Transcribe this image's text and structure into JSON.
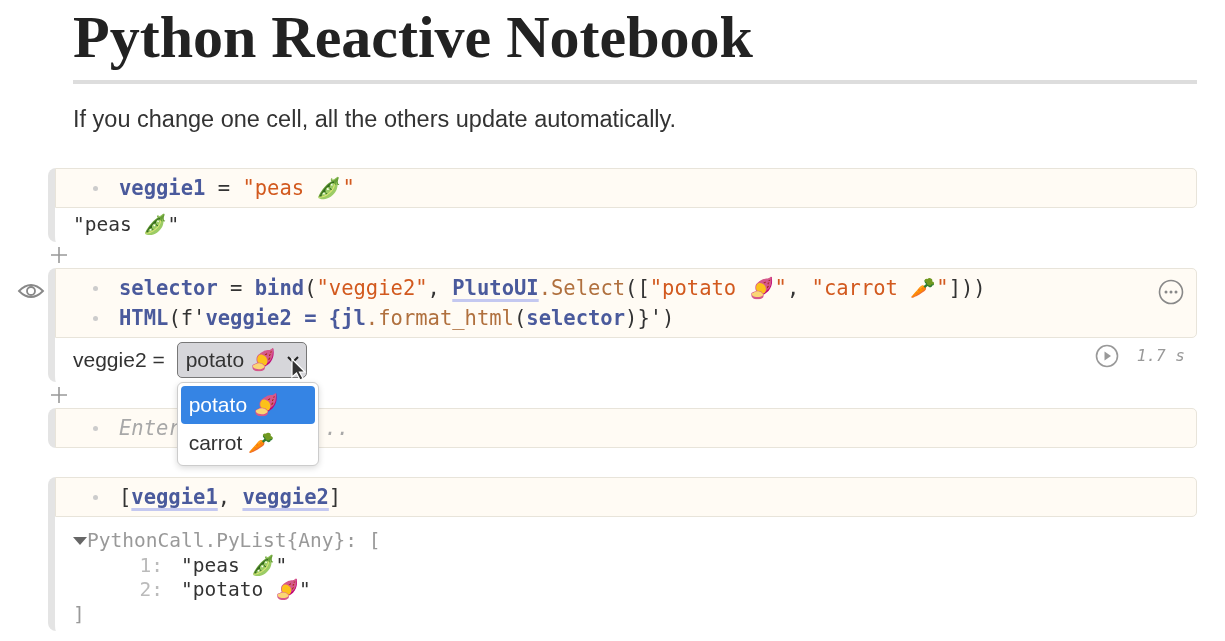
{
  "title": "Python Reactive Notebook",
  "intro": "If you change one cell, all the others update automatically.",
  "cells": [
    {
      "lines": [
        [
          {
            "kind": "var",
            "text": "veggie1"
          },
          {
            "kind": "punct",
            "text": " = "
          },
          {
            "kind": "str",
            "text": "\"peas 🫛\""
          }
        ]
      ],
      "output": {
        "kind": "text",
        "text": "\"peas 🫛\""
      },
      "add_after": true
    },
    {
      "eye": true,
      "menu": true,
      "runtime": "1.7 s",
      "lines": [
        [
          {
            "kind": "var",
            "text": "selector"
          },
          {
            "kind": "punct",
            "text": " = "
          },
          {
            "kind": "var",
            "text": "bind"
          },
          {
            "kind": "punct",
            "text": "("
          },
          {
            "kind": "str",
            "text": "\"veggie2\""
          },
          {
            "kind": "punct",
            "text": ", "
          },
          {
            "kind": "ref",
            "text": "PlutoUI"
          },
          {
            "kind": "method",
            "text": ".Select"
          },
          {
            "kind": "punct",
            "text": "(["
          },
          {
            "kind": "str",
            "text": "\"potato 🍠\""
          },
          {
            "kind": "punct",
            "text": ", "
          },
          {
            "kind": "str",
            "text": "\"carrot 🥕\""
          },
          {
            "kind": "punct",
            "text": "]))"
          }
        ],
        [
          {
            "kind": "var",
            "text": "HTML"
          },
          {
            "kind": "punct",
            "text": "(f'"
          },
          {
            "kind": "var",
            "text": "veggie2 = {jl"
          },
          {
            "kind": "method",
            "text": ".format_html"
          },
          {
            "kind": "punct",
            "text": "("
          },
          {
            "kind": "var",
            "text": "selector"
          },
          {
            "kind": "punct",
            "text": ")}')"
          }
        ]
      ],
      "output": {
        "kind": "select",
        "label": "veggie2 =",
        "value": "potato 🍠",
        "expanded": true,
        "options": [
          {
            "label": "potato 🍠",
            "selected": true
          },
          {
            "label": "carrot 🥕",
            "selected": false
          }
        ]
      },
      "add_after": true
    },
    {
      "placeholder": "Enter",
      "placeholder_end": ".."
    },
    {
      "lines": [
        [
          {
            "kind": "punct",
            "text": "["
          },
          {
            "kind": "ref",
            "text": "veggie1"
          },
          {
            "kind": "punct",
            "text": ", "
          },
          {
            "kind": "ref",
            "text": "veggie2"
          },
          {
            "kind": "punct",
            "text": "]"
          }
        ]
      ],
      "output": {
        "kind": "tree",
        "header": "PythonCall.PyList{Any}: [",
        "expanded": true,
        "items": [
          {
            "index": "1:",
            "value": "\"peas 🫛\""
          },
          {
            "index": "2:",
            "value": "\"potato 🍠\""
          }
        ],
        "footer": "]"
      }
    }
  ]
}
